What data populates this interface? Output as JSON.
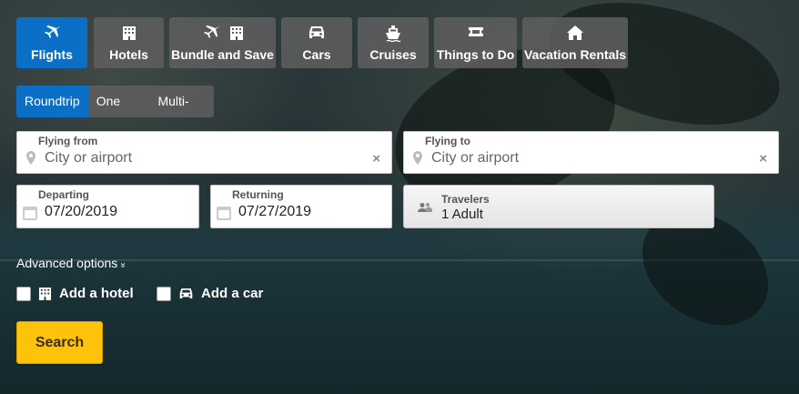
{
  "tabs": [
    {
      "label": "Flights",
      "icon": "plane-icon",
      "active": true
    },
    {
      "label": "Hotels",
      "icon": "hotel-icon",
      "active": false
    },
    {
      "label": "Bundle and Save",
      "icon": "plane-hotel-icon",
      "active": false
    },
    {
      "label": "Cars",
      "icon": "car-icon",
      "active": false
    },
    {
      "label": "Cruises",
      "icon": "cruise-icon",
      "active": false
    },
    {
      "label": "Things to Do",
      "icon": "ticket-icon",
      "active": false
    },
    {
      "label": "Vacation Rentals",
      "icon": "house-icon",
      "active": false
    }
  ],
  "trip_types": [
    {
      "label": "Roundtrip",
      "active": true
    },
    {
      "label": "One way",
      "active": false
    },
    {
      "label": "Multi-City",
      "active": false
    }
  ],
  "flying_from": {
    "label": "Flying from",
    "placeholder": "City or airport",
    "value": ""
  },
  "flying_to": {
    "label": "Flying to",
    "placeholder": "City or airport",
    "value": ""
  },
  "departing": {
    "label": "Departing",
    "value": "07/20/2019"
  },
  "returning": {
    "label": "Returning",
    "value": "07/27/2019"
  },
  "travelers": {
    "label": "Travelers",
    "value": "1 Adult"
  },
  "advanced_options": {
    "label": "Advanced options",
    "chevron": "»"
  },
  "addons": [
    {
      "label": "Add a hotel",
      "icon": "hotel-icon",
      "checked": false
    },
    {
      "label": "Add a car",
      "icon": "car-icon",
      "checked": false
    }
  ],
  "search": {
    "label": "Search"
  },
  "colors": {
    "accent": "#0b6fc6",
    "search_button": "#fdc30a",
    "tab_bg": "#5f5f5f"
  }
}
